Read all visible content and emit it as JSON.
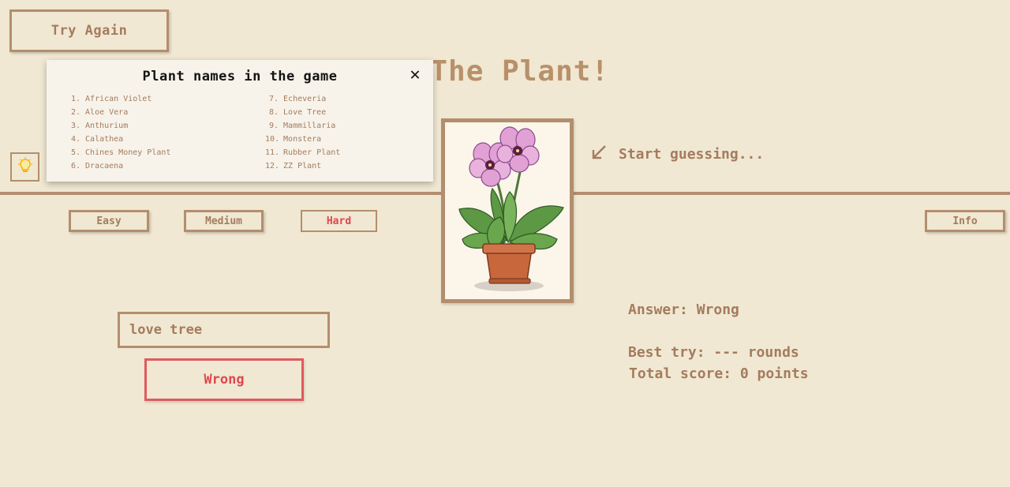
{
  "header": {
    "try_again_label": "Try Again",
    "title_visible": "s The Plant!"
  },
  "hint": {
    "icon": "lightbulb-icon",
    "prompt": "Start guessing...",
    "prompt_icon": "arrow-down-left-icon"
  },
  "difficulty": {
    "easy": "Easy",
    "medium": "Medium",
    "hard": "Hard",
    "selected": "Hard"
  },
  "info_label": "Info",
  "guess": {
    "input_value": "love tree",
    "submit_label": "Wrong"
  },
  "stats": {
    "answer_line": "Answer: Wrong",
    "best_line": "Best try: --- rounds",
    "score_line": "Total score: 0 points"
  },
  "modal": {
    "title": "Plant names in the game",
    "close_glyph": "✕",
    "plants": [
      {
        "num": "1.",
        "name": "African Violet"
      },
      {
        "num": "2.",
        "name": "Aloe Vera"
      },
      {
        "num": "3.",
        "name": "Anthurium"
      },
      {
        "num": "4.",
        "name": "Calathea"
      },
      {
        "num": "5.",
        "name": "Chines Money Plant"
      },
      {
        "num": "6.",
        "name": "Dracaena"
      },
      {
        "num": "7.",
        "name": "Echeveria"
      },
      {
        "num": "8.",
        "name": "Love Tree"
      },
      {
        "num": "9.",
        "name": "Mammillaria"
      },
      {
        "num": "10.",
        "name": "Monstera"
      },
      {
        "num": "11.",
        "name": "Rubber Plant"
      },
      {
        "num": "12.",
        "name": "ZZ Plant"
      }
    ]
  },
  "colors": {
    "background": "#f0e8d2",
    "border": "#b38e6e",
    "text": "#a57b5e",
    "accent_red": "#e0464f"
  }
}
